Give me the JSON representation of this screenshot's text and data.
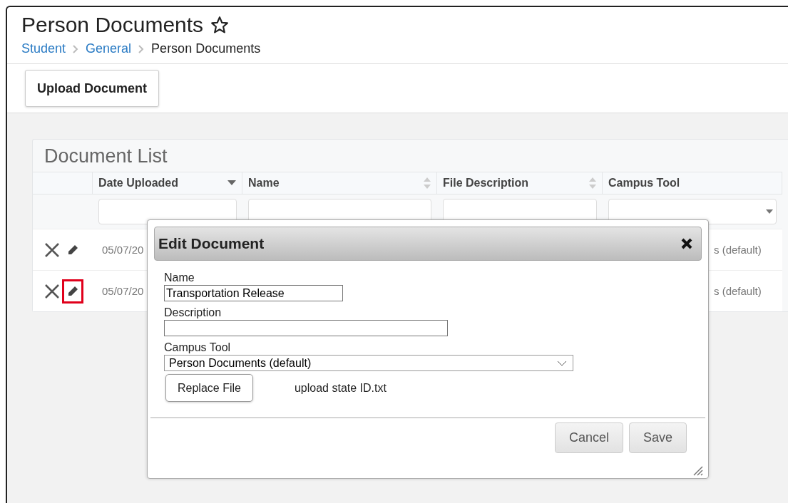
{
  "page": {
    "title": "Person Documents",
    "favorite": false
  },
  "breadcrumb": [
    {
      "label": "Student",
      "kind": "link"
    },
    {
      "label": "General",
      "kind": "link"
    },
    {
      "label": "Person Documents",
      "kind": "current"
    }
  ],
  "toolbar": {
    "buttons": [
      "Upload Document"
    ]
  },
  "document_list": {
    "title": "Document List",
    "columns": [
      {
        "label": "Date Uploaded",
        "kind": "text",
        "sortable": true,
        "sorted": true
      },
      {
        "label": "Name",
        "kind": "text",
        "sortable": true,
        "sorted": false
      },
      {
        "label": "File Description",
        "kind": "text",
        "sortable": true,
        "sorted": false
      },
      {
        "label": "Campus Tool",
        "kind": "select",
        "sortable": false,
        "sorted": false
      }
    ],
    "rows": [
      {
        "date": "05/07/20",
        "campus_tool": "s (default)",
        "highlighted": false
      },
      {
        "date": "05/07/20",
        "campus_tool": "s (default)",
        "highlighted": true
      }
    ]
  },
  "dialog": {
    "title": "Edit Document",
    "fields": [
      {
        "label": "Name",
        "value": "Transportation Release",
        "kind": "text"
      },
      {
        "label": "Description",
        "kind": "text"
      },
      {
        "label": "Campus Tool",
        "value": "Person Documents (default)",
        "kind": "select"
      }
    ],
    "replace_button": "Replace File",
    "file_name": "upload state ID.txt",
    "buttons": [
      "Cancel",
      "Save"
    ]
  }
}
